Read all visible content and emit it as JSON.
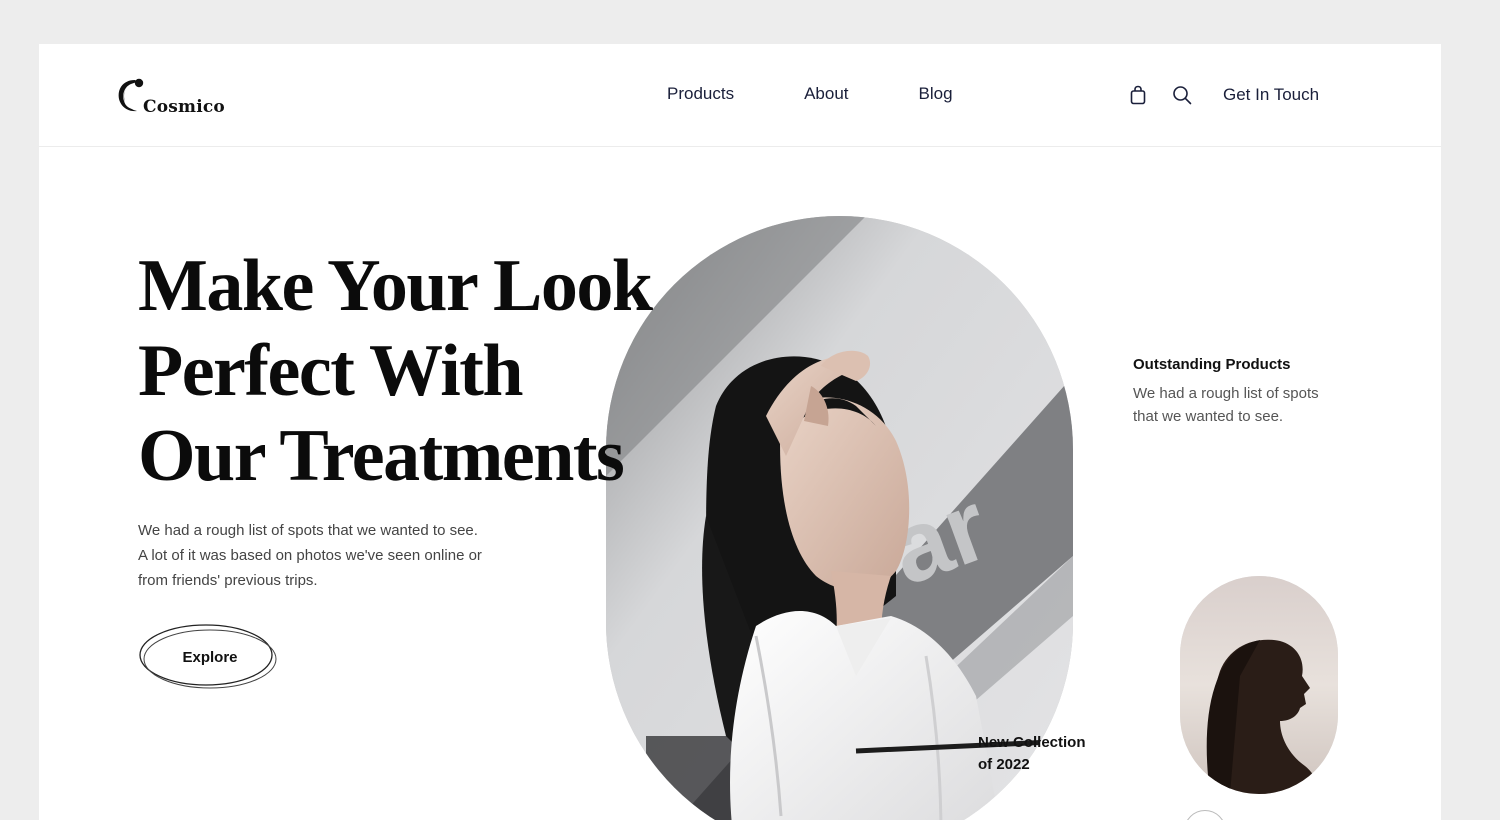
{
  "brand": {
    "name": "Cosmico",
    "logo_icon": "crescent-swirl-icon"
  },
  "nav": {
    "items": [
      {
        "label": "Products"
      },
      {
        "label": "About"
      },
      {
        "label": "Blog"
      }
    ]
  },
  "actions": {
    "bag_icon": "shopping-bag-icon",
    "search_icon": "search-icon",
    "cta_label": "Get In Touch"
  },
  "hero": {
    "headline_lines": [
      "Make Your Look",
      "Perfect With",
      "Our Treatments"
    ],
    "description_lines": [
      "We had a rough list of spots that we wanted to see.",
      "A lot of it was based on photos we've seen online or",
      "from friends' previous trips."
    ],
    "explore_label": "Explore",
    "image_subject": "woman-with-hand-on-forehead-photo",
    "collection_lines": [
      "New Collection",
      "of 2022"
    ]
  },
  "side": {
    "title": "Outstanding Products",
    "description_lines": [
      "We had a rough list of spots",
      "that we wanted to see."
    ],
    "image_subject": "woman-silhouette-profile-photo"
  },
  "colors": {
    "background": "#ededed",
    "page": "#ffffff",
    "nav_text": "#1a1f3a",
    "headline": "#0b0b0b",
    "body_text": "#444444"
  }
}
